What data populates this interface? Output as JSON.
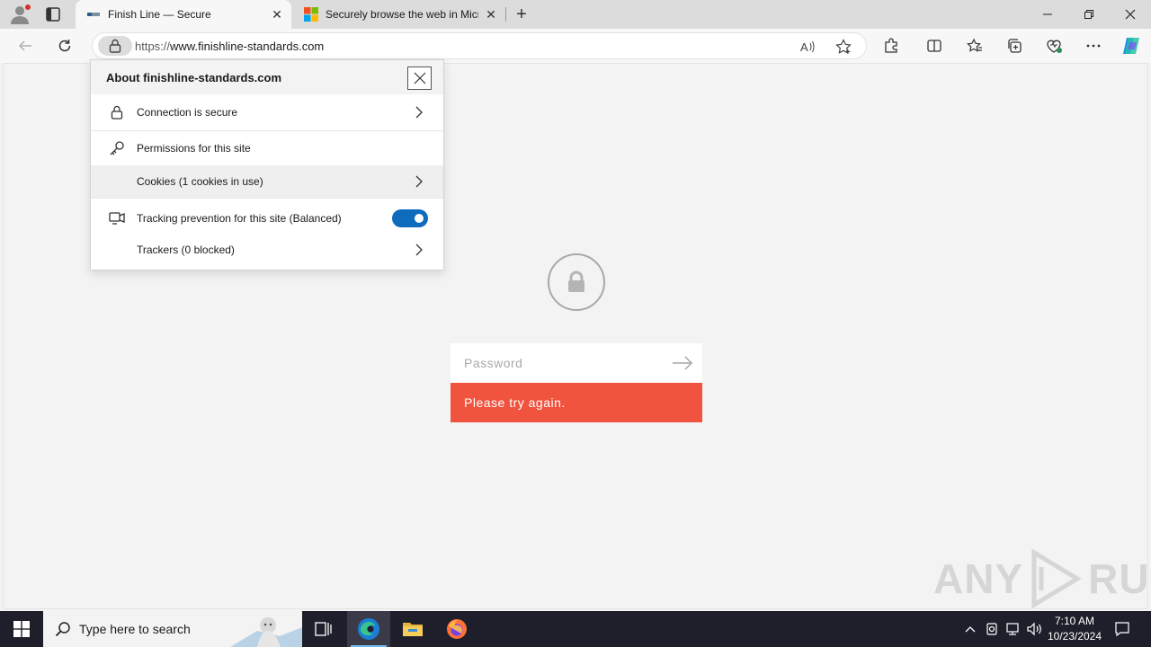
{
  "browser": {
    "tabs": [
      {
        "title": "Finish Line — Secure",
        "active": true,
        "favicon": "site-favicon"
      },
      {
        "title": "Securely browse the web in Microsoft Edge",
        "active": false,
        "favicon": "microsoft-logo"
      }
    ],
    "address": {
      "protocol": "https://",
      "host": "www.finishline-standards.com"
    }
  },
  "site_info": {
    "title": "About finishline-standards.com",
    "connection_label": "Connection is secure",
    "permissions_label": "Permissions for this site",
    "cookies_label": "Cookies (1 cookies in use)",
    "tracking_label": "Tracking prevention for this site (Balanced)",
    "tracking_enabled": true,
    "trackers_label": "Trackers (0 blocked)"
  },
  "page": {
    "password_placeholder": "Password",
    "error_message": "Please try again."
  },
  "watermark": {
    "left": "ANY",
    "right": "RUN"
  },
  "taskbar": {
    "search_placeholder": "Type here to search",
    "time": "7:10 AM",
    "date": "10/23/2024"
  },
  "colors": {
    "error": "#f0533e",
    "toggle_on": "#0f6cbd",
    "taskbar": "#1f1f2b"
  }
}
